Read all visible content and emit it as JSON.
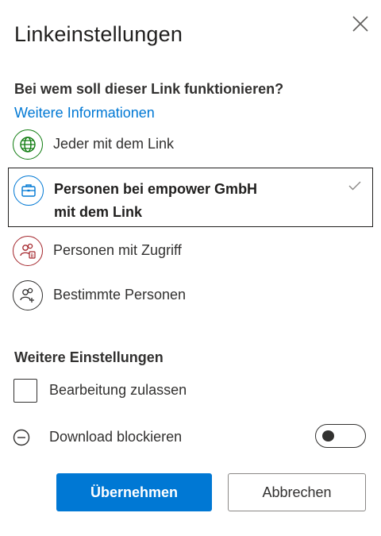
{
  "dialog": {
    "title": "Linkeinstellungen",
    "close_icon": "close-icon"
  },
  "audience": {
    "question": "Bei wem soll dieser Link funktionieren?",
    "more_info_link": "Weitere Informationen",
    "options": [
      {
        "label": "Jeder mit dem Link",
        "icon": "globe-icon",
        "color": "#107c10",
        "selected": false
      },
      {
        "label_line1": "Personen bei empower GmbH",
        "label_line2": "mit dem Link",
        "icon": "briefcase-icon",
        "color": "#0078d4",
        "selected": true
      },
      {
        "label": "Personen mit Zugriff",
        "icon": "people-access-icon",
        "color": "#a4262c",
        "selected": false
      },
      {
        "label": "Bestimmte Personen",
        "icon": "people-add-icon",
        "color": "#323130",
        "selected": false
      }
    ]
  },
  "more_settings": {
    "heading": "Weitere Einstellungen",
    "allow_editing": {
      "label": "Bearbeitung zulassen",
      "checked": false
    },
    "block_download": {
      "label": "Download blockieren",
      "icon": "minus-circle-icon",
      "toggle_on": false
    }
  },
  "buttons": {
    "apply": "Übernehmen",
    "cancel": "Abbrechen"
  },
  "colors": {
    "accent": "#0078d4",
    "text": "#323130",
    "globe_green": "#107c10",
    "access_red": "#a4262c"
  }
}
